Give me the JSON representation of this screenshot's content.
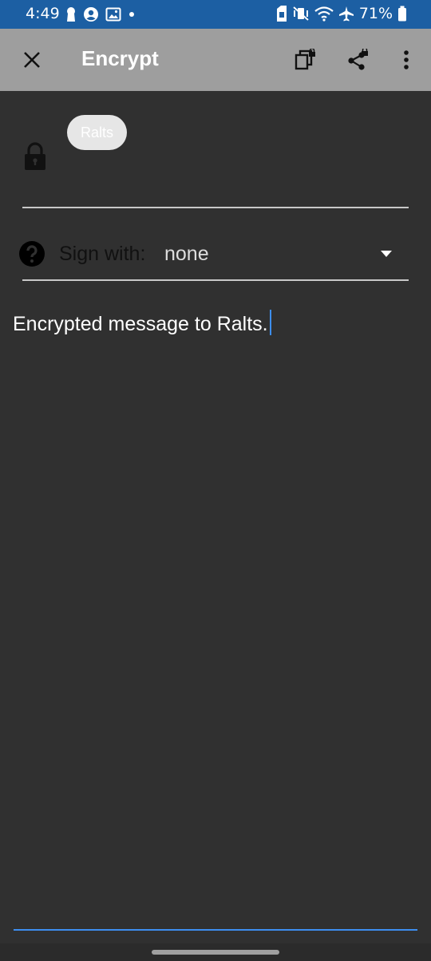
{
  "status_bar": {
    "time": "4:49",
    "battery": "71%",
    "left_icons": [
      "keyhole-icon",
      "account-circle-icon",
      "image-icon",
      "dot-icon"
    ],
    "right_icons": [
      "sim-icon",
      "vibrate-mute-icon",
      "wifi-icon",
      "airplane-icon",
      "battery-icon"
    ]
  },
  "toolbar": {
    "title": "Encrypt",
    "close_icon": "close-icon",
    "copy_icon": "copy-encrypted-icon",
    "share_icon": "share-encrypted-icon",
    "menu_icon": "more-vert-icon"
  },
  "recipients": {
    "chips": [
      "Ralts"
    ],
    "icon": "lock-icon"
  },
  "sign": {
    "label": "Sign with:",
    "value": "none",
    "icon": "help-icon"
  },
  "message": {
    "text": "Encrypted message to Ralts."
  },
  "colors": {
    "status_bar": "#1c5fa3",
    "toolbar": "#9e9e9e",
    "background": "#303030",
    "accent": "#3d8ef0"
  }
}
